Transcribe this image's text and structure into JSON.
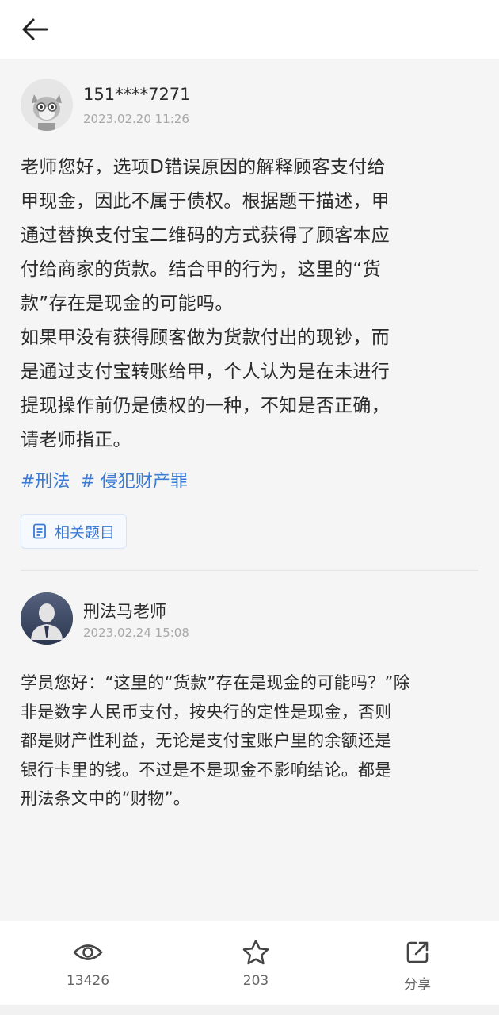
{
  "question": {
    "user_name": "151****7271",
    "time": "2023.02.20  11:26",
    "lines": [
      "老师您好，选项D错误原因的解释顾客支付给",
      "甲现金，因此不属于债权。根据题干描述，甲",
      "通过替换支付宝二维码的方式获得了顾客本应",
      "付给商家的货款。结合甲的行为，这里的“货",
      "款”存在是现金的可能吗。",
      "如果甲没有获得顾客做为货款付出的现钞，而",
      "是通过支付宝转账给甲，个人认为是在未进行",
      "提现操作前仍是债权的一种，不知是否正确，",
      "请老师指正。"
    ],
    "tags": [
      "#刑法",
      "# 侵犯财产罪"
    ],
    "related_label": "相关题目"
  },
  "answer": {
    "user_name": "刑法马老师",
    "time": "2023.02.24  15:08",
    "lines": [
      "学员您好：“这里的“货款”存在是现金的可能吗？”除",
      "非是数字人民币支付，按央行的定性是现金，否则",
      "都是财产性利益，无论是支付宝账户里的余额还是",
      "银行卡里的钱。不过是不是现金不影响结论。都是",
      "刑法条文中的“财物”。"
    ]
  },
  "bottom_bar": {
    "views": "13426",
    "stars": "203",
    "share": "分享"
  },
  "icons": {
    "back": "back-arrow-icon",
    "views": "eye-icon",
    "stars": "star-icon",
    "share": "share-icon",
    "related": "document-icon"
  },
  "colors": {
    "accent": "#3a7bd5",
    "background": "#f5f5f5",
    "text": "#2b2b2b",
    "muted": "#a8a8a8"
  }
}
